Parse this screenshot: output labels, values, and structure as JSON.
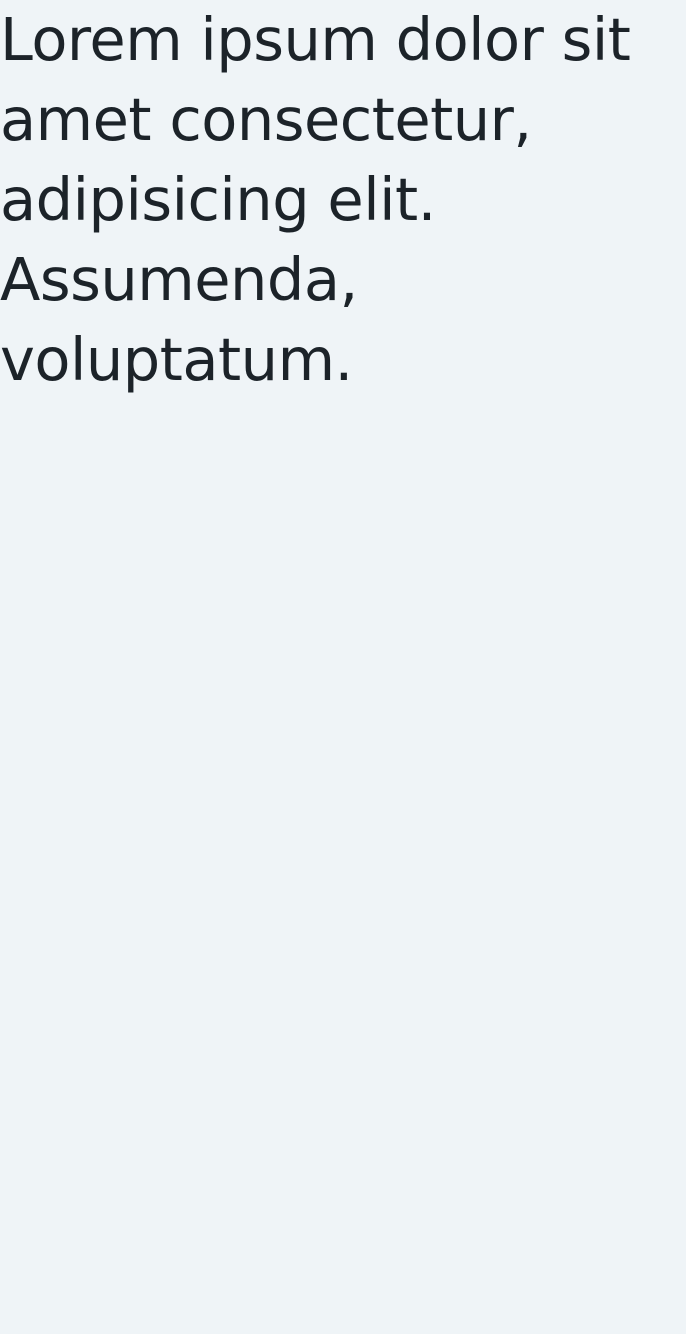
{
  "main": {
    "paragraph": "Lorem ipsum dolor sit amet consectetur, adipisicing elit. Assumenda, voluptatum."
  },
  "colors": {
    "background": "#eff4f7",
    "text": "#1c2329"
  }
}
